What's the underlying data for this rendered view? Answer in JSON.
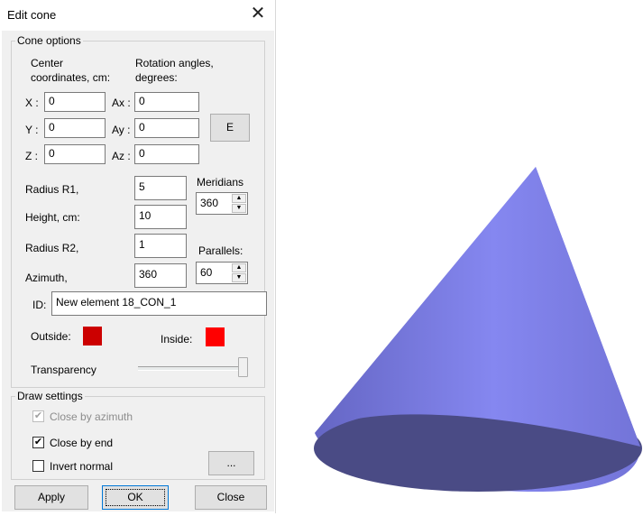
{
  "window": {
    "title": "Edit cone",
    "close_glyph": "✕"
  },
  "cone_options": {
    "legend": "Cone options",
    "center_label_1": "Center",
    "center_label_2": "coordinates, cm:",
    "rotation_label_1": "Rotation angles,",
    "rotation_label_2": "degrees:",
    "x_label": "X :",
    "y_label": "Y :",
    "z_label": "Z :",
    "x_value": "0",
    "y_value": "0",
    "z_value": "0",
    "ax_label": "Ax :",
    "ay_label": "Ay :",
    "az_label": "Az :",
    "ax_value": "0",
    "ay_value": "0",
    "az_value": "0",
    "e_button": "E",
    "radius_r1_label": "Radius R1,",
    "radius_r1_value": "5",
    "height_label": "Height, cm:",
    "height_value": "10",
    "radius_r2_label": "Radius R2,",
    "radius_r2_value": "1",
    "azimuth_label": "Azimuth,",
    "azimuth_value": "360",
    "meridians_label": "Meridians",
    "meridians_value": "360",
    "parallels_label": "Parallels:",
    "parallels_value": "60",
    "id_label": "ID:",
    "id_value": "New element 18_CON_1",
    "outside_label": "Outside:",
    "inside_label": "Inside:",
    "outside_color": "#cc0000",
    "inside_color": "#ff0000",
    "transparency_label": "Transparency",
    "transparency_level": 1.0
  },
  "draw_settings": {
    "legend": "Draw settings",
    "close_by_azimuth": "Close by azimuth",
    "close_by_end": "Close by end",
    "invert_normal": "Invert normal",
    "more_button": "..."
  },
  "buttons": {
    "apply": "Apply",
    "ok": "OK",
    "close": "Close"
  },
  "preview": {
    "cone_color": "#7f80e6"
  }
}
